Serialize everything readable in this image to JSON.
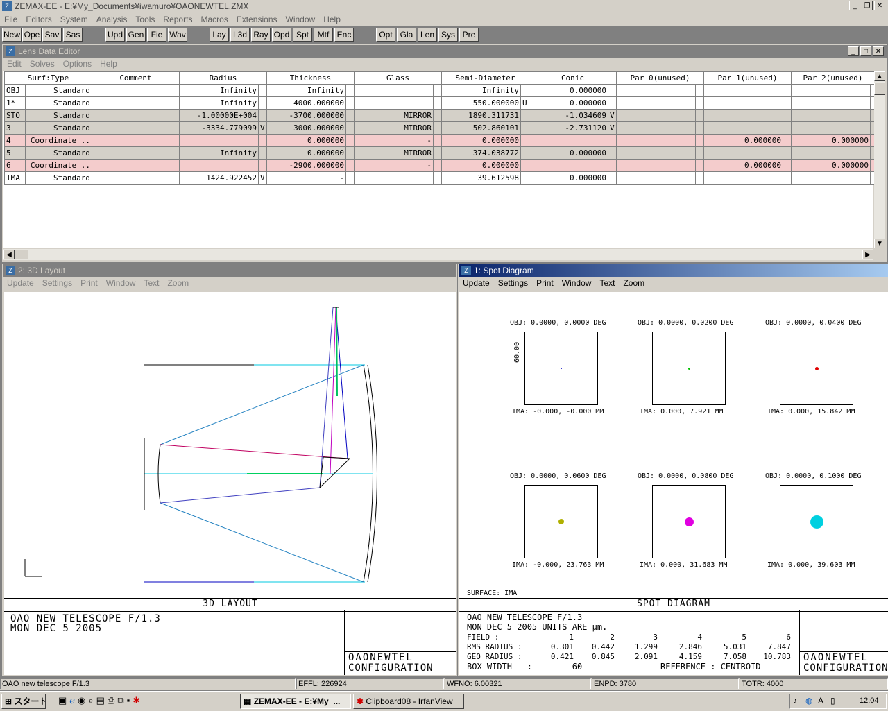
{
  "app_title": "ZEMAX-EE - E:¥My_Documents¥iwamuro¥OAONEWTEL.ZMX",
  "menu": [
    "File",
    "Editors",
    "System",
    "Analysis",
    "Tools",
    "Reports",
    "Macros",
    "Extensions",
    "Window",
    "Help"
  ],
  "toolbar": [
    "New",
    "Ope",
    "Sav",
    "Sas",
    "Upd",
    "Gen",
    "Fie",
    "Wav",
    "Lay",
    "L3d",
    "Ray",
    "Opd",
    "Spt",
    "Mtf",
    "Enc",
    "Opt",
    "Gla",
    "Len",
    "Sys",
    "Pre"
  ],
  "lde": {
    "title": "Lens Data Editor",
    "menu": [
      "Edit",
      "Solves",
      "Options",
      "Help"
    ],
    "headers": [
      "Surf:Type",
      "Comment",
      "Radius",
      "Thickness",
      "Glass",
      "Semi-Diameter",
      "Conic",
      "Par 0(unused)",
      "Par 1(unused)",
      "Par 2(unused)"
    ],
    "rows": [
      {
        "surf": "OBJ",
        "type": "Standard",
        "comment": "",
        "radius": "Infinity",
        "rs": "",
        "thick": "Infinity",
        "ts": "",
        "glass": "",
        "semi": "Infinity",
        "ss": "",
        "conic": "0.000000",
        "cs": "",
        "p0": "",
        "p1": "",
        "p2": "",
        "style": "white"
      },
      {
        "surf": "1*",
        "type": "Standard",
        "comment": "",
        "radius": "Infinity",
        "rs": "",
        "thick": "4000.000000",
        "ts": "",
        "glass": "",
        "semi": "550.000000",
        "ss": "U",
        "conic": "0.000000",
        "cs": "",
        "p0": "",
        "p1": "",
        "p2": "",
        "style": "white"
      },
      {
        "surf": "STO",
        "type": "Standard",
        "comment": "",
        "radius": "-1.00000E+004",
        "rs": "",
        "thick": "-3700.000000",
        "ts": "",
        "glass": "MIRROR",
        "semi": "1890.311731",
        "ss": "",
        "conic": "-1.034609",
        "cs": "V",
        "p0": "",
        "p1": "",
        "p2": "",
        "style": "grey"
      },
      {
        "surf": "3",
        "type": "Standard",
        "comment": "",
        "radius": "-3334.779099",
        "rs": "V",
        "thick": "3000.000000",
        "ts": "",
        "glass": "MIRROR",
        "semi": "502.860101",
        "ss": "",
        "conic": "-2.731120",
        "cs": "V",
        "p0": "",
        "p1": "",
        "p2": "",
        "style": "grey"
      },
      {
        "surf": "4",
        "type": "Coordinate ..",
        "comment": "",
        "radius": "",
        "rs": "",
        "thick": "0.000000",
        "ts": "",
        "glass": "-",
        "semi": "0.000000",
        "ss": "",
        "conic": "",
        "cs": "",
        "p0": "",
        "p1": "0.000000",
        "p2": "0.000000",
        "style": "pink"
      },
      {
        "surf": "5",
        "type": "Standard",
        "comment": "",
        "radius": "Infinity",
        "rs": "",
        "thick": "0.000000",
        "ts": "",
        "glass": "MIRROR",
        "semi": "374.038772",
        "ss": "",
        "conic": "0.000000",
        "cs": "",
        "p0": "",
        "p1": "",
        "p2": "",
        "style": "grey"
      },
      {
        "surf": "6",
        "type": "Coordinate ..",
        "comment": "",
        "radius": "",
        "rs": "",
        "thick": "-2900.000000",
        "ts": "",
        "glass": "-",
        "semi": "0.000000",
        "ss": "",
        "conic": "",
        "cs": "",
        "p0": "",
        "p1": "0.000000",
        "p2": "0.000000",
        "style": "pink"
      },
      {
        "surf": "IMA",
        "type": "Standard",
        "comment": "",
        "radius": "1424.922452",
        "rs": "V",
        "thick": "-",
        "ts": "",
        "glass": "",
        "semi": "39.612598",
        "ss": "",
        "conic": "0.000000",
        "cs": "",
        "p0": "",
        "p1": "",
        "p2": "",
        "style": "white"
      }
    ]
  },
  "layout": {
    "title": "2: 3D Layout",
    "menu": [
      "Update",
      "Settings",
      "Print",
      "Window",
      "Text",
      "Zoom"
    ],
    "heading": "3D LAYOUT",
    "line1": "OAO NEW TELESCOPE F/1.3",
    "line2": "MON DEC 5 2005",
    "file": "OAONEWTEL",
    "config": "CONFIGURATION"
  },
  "spot": {
    "title": "1: Spot Diagram",
    "menu": [
      "Update",
      "Settings",
      "Print",
      "Window",
      "Text",
      "Zoom"
    ],
    "scale_label": "60.00",
    "cells": [
      {
        "obj": "OBJ: 0.0000, 0.0000 DEG",
        "ima": "IMA: -0.000, -0.000 MM",
        "color": "#0000c0",
        "size": 2.5
      },
      {
        "obj": "OBJ: 0.0000, 0.0200 DEG",
        "ima": "IMA: 0.000, 7.921 MM",
        "color": "#00c000",
        "size": 3
      },
      {
        "obj": "OBJ: 0.0000, 0.0400 DEG",
        "ima": "IMA: 0.000, 15.842 MM",
        "color": "#e00000",
        "size": 5
      },
      {
        "obj": "OBJ: 0.0000, 0.0600 DEG",
        "ima": "IMA: -0.000, 23.763 MM",
        "color": "#b0b000",
        "size": 8
      },
      {
        "obj": "OBJ: 0.0000, 0.0800 DEG",
        "ima": "IMA: 0.000, 31.683 MM",
        "color": "#e000e0",
        "size": 13
      },
      {
        "obj": "OBJ: 0.0000, 0.1000 DEG",
        "ima": "IMA: 0.000, 39.603 MM",
        "color": "#00d0e0",
        "size": 19
      }
    ],
    "surface": "SURFACE: IMA",
    "heading": "SPOT DIAGRAM",
    "line1": "OAO NEW TELESCOPE F/1.3",
    "line2": "MON DEC 5 2005   UNITS ARE µm.",
    "field_label": "FIELD      :",
    "fields": [
      "1",
      "2",
      "3",
      "4",
      "5",
      "6"
    ],
    "rms_label": "RMS RADIUS :",
    "rms": [
      "0.301",
      "0.442",
      "1.299",
      "2.846",
      "5.031",
      "7.847"
    ],
    "geo_label": "GEO RADIUS :",
    "geo": [
      "0.421",
      "0.845",
      "2.091",
      "4.159",
      "7.058",
      "10.783"
    ],
    "box_line": "BOX WIDTH   :        60",
    "ref_line": "REFERENCE  : CENTROID",
    "file": "OAONEWTEL",
    "config": "CONFIGURATION"
  },
  "status": {
    "title": "OAO new telescope F/1.3",
    "effl": "EFFL: 226924",
    "wfno": "WFNO: 6.00321",
    "enpd": "ENPD: 3780",
    "totr": "TOTR: 4000"
  },
  "taskbar": {
    "start": "スタート",
    "item1": "ZEMAX-EE - E:¥My_...",
    "item2": "Clipboard08 - IrfanView",
    "clock": "12:04"
  }
}
